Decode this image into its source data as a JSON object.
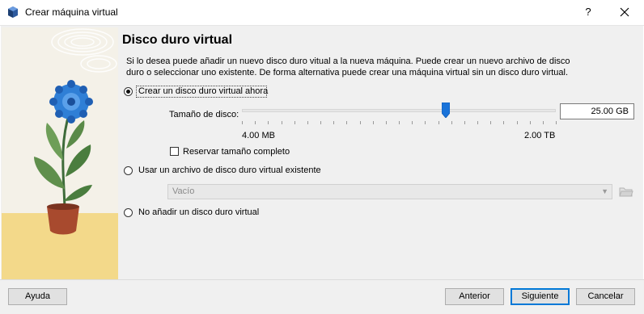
{
  "window": {
    "title": "Crear máquina virtual",
    "help_label": "?",
    "close_label": "✕"
  },
  "page": {
    "heading": "Disco duro virtual",
    "description": "Si lo desea puede añadir un nuevo disco duro vitual a la nueva máquina. Puede crear un nuevo archivo de disco duro o seleccionar uno existente. De forma alternativa puede crear una máquina virtual sin un disco duro virtual."
  },
  "options": {
    "create_new": {
      "label": "Crear un disco duro virtual ahora",
      "selected": true
    },
    "use_existing": {
      "label": "Usar un archivo de disco duro virtual existente",
      "selected": false
    },
    "no_disk": {
      "label": "No añadir un disco duro virtual",
      "selected": false
    }
  },
  "disk_size": {
    "label": "Tamaño de disco:",
    "value": "25.00 GB",
    "min_label": "4.00 MB",
    "max_label": "2.00 TB",
    "slider_fraction": 0.65
  },
  "reserve": {
    "label": "Reservar tamaño completo",
    "checked": false
  },
  "existing_file": {
    "selected": "Vacío"
  },
  "buttons": {
    "help": "Ayuda",
    "back": "Anterior",
    "next": "Siguiente",
    "cancel": "Cancelar"
  },
  "colors": {
    "accent": "#0078d7",
    "slider_thumb": "#1a73d9",
    "flower": "#2f7fd6",
    "pot": "#a84a2e",
    "ground": "#f3d98a"
  }
}
